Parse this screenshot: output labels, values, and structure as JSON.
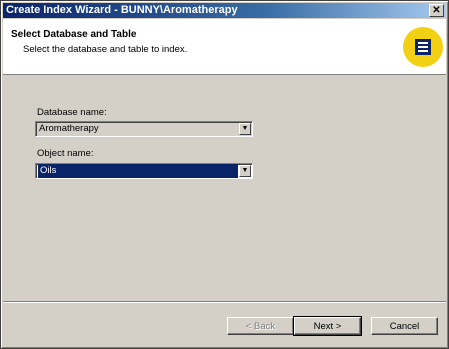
{
  "window": {
    "title": "Create Index Wizard - BUNNY\\Aromatherapy",
    "close_glyph": "✕"
  },
  "header": {
    "title": "Select Database and Table",
    "subtitle": "Select the database and table to index.",
    "icon": "index-wizard-icon"
  },
  "form": {
    "database_label": "Database name:",
    "database_value": "Aromatherapy",
    "object_label": "Object name:",
    "object_value": "Oils"
  },
  "buttons": {
    "back": "< Back",
    "next": "Next >",
    "cancel": "Cancel"
  },
  "icons": {
    "dropdown": "▼"
  }
}
